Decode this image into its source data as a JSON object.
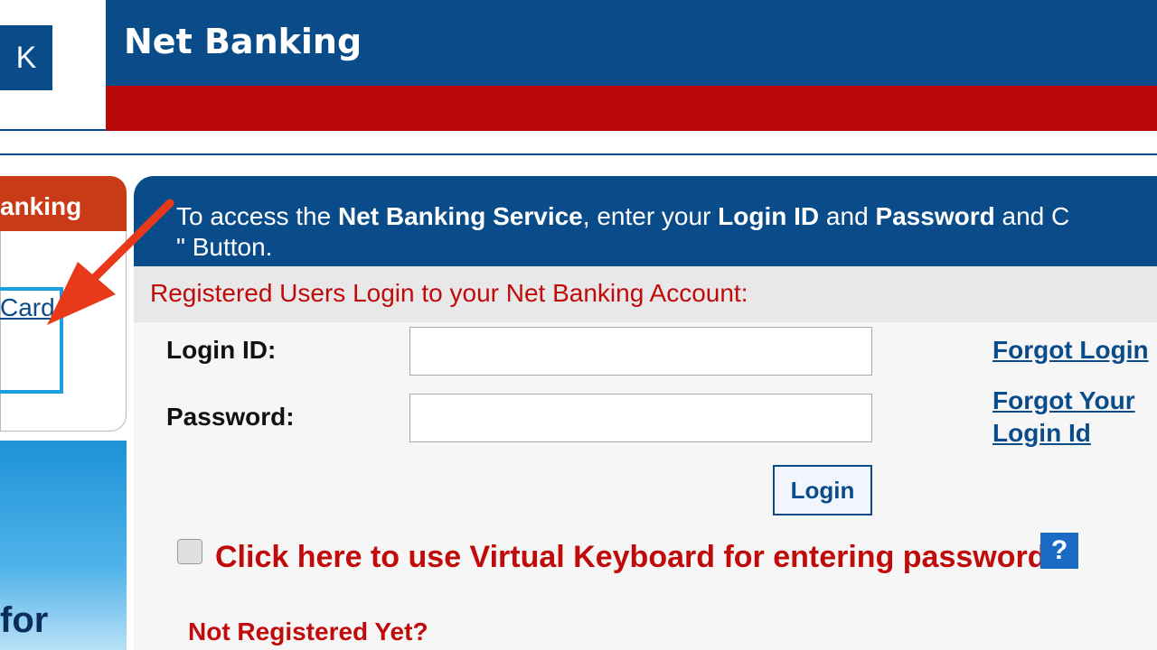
{
  "header": {
    "logo_letter": "K",
    "title": "Net Banking"
  },
  "left_panel": {
    "tab_label": "anking",
    "card_link": "Card",
    "promo_text": "for"
  },
  "instructions": {
    "part1": "To access the ",
    "service": "Net Banking Service",
    "part2": ", enter your ",
    "login_id": "Login ID",
    "part3": " and ",
    "password": "Password",
    "part4": " and C",
    "line2": "\" Button."
  },
  "registered_heading": "Registered Users Login to your Net Banking Account:",
  "form": {
    "login_label": "Login ID:",
    "login_value": "",
    "password_label": "Password:",
    "password_value": "",
    "login_button": "Login"
  },
  "links": {
    "forgot_login": "Forgot Login",
    "forgot_your": "Forgot Your",
    "login_id": "Login Id"
  },
  "virtual_keyboard": {
    "text": "Click here to use Virtual Keyboard for entering password",
    "help_symbol": "?"
  },
  "not_registered": "Not Registered Yet?",
  "colors": {
    "primary_blue": "#0a4c8a",
    "header_red": "#b80808",
    "tab_orange": "#c93a16",
    "text_red": "#c10a0a",
    "highlight_cyan": "#1aa0e0",
    "arrow_red": "#e83a1a"
  }
}
